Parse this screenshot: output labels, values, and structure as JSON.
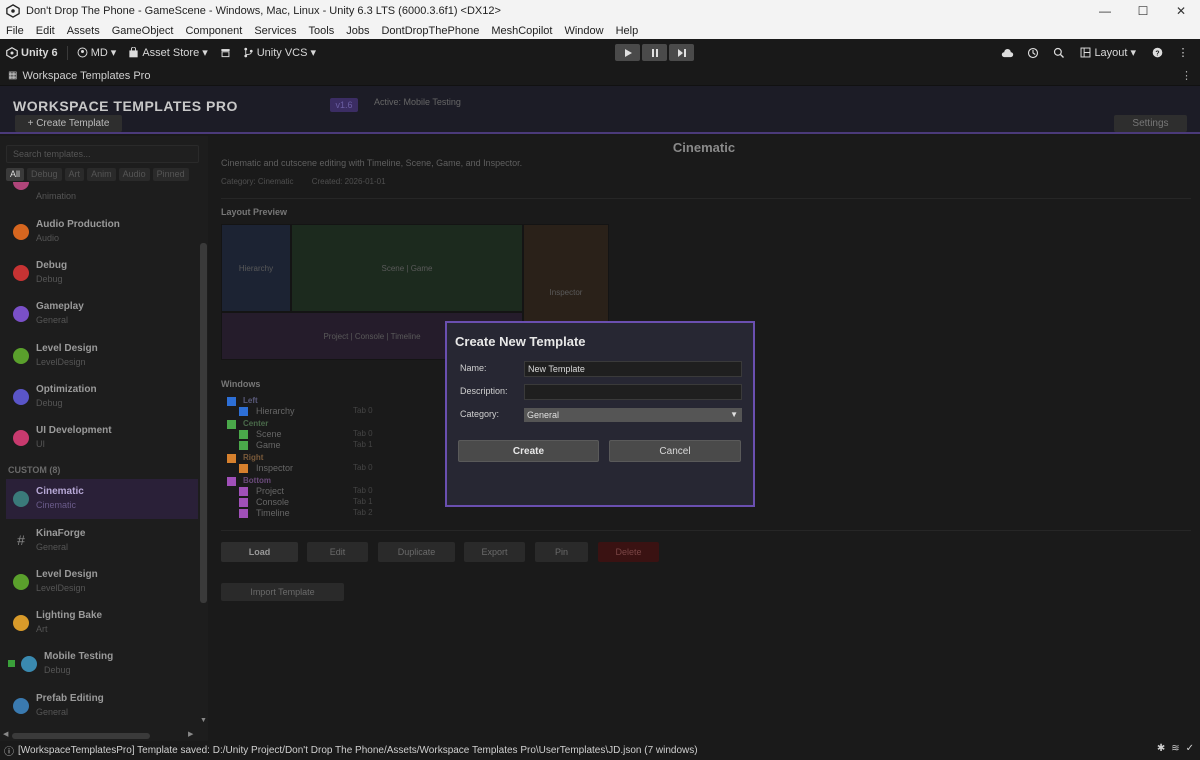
{
  "window": {
    "title": "Don't Drop The Phone - GameScene - Windows, Mac, Linux - Unity 6.3 LTS (6000.3.6f1) <DX12>",
    "controls": [
      "—",
      "☐",
      "✕"
    ]
  },
  "menu": [
    "File",
    "Edit",
    "Assets",
    "GameObject",
    "Component",
    "Services",
    "Tools",
    "Jobs",
    "DontDropThePhone",
    "MeshCopilot",
    "Window",
    "Help"
  ],
  "toolbar": {
    "unity_label": "Unity 6",
    "account_label": "MD",
    "asset_store_label": "Asset Store",
    "vcs_label": "Unity VCS",
    "layout_label": "Layout"
  },
  "window_tab": {
    "label": "Workspace Templates Pro"
  },
  "header": {
    "title": "WORKSPACE TEMPLATES PRO",
    "version": "v1.6",
    "active": "Active: Mobile Testing",
    "create_button": "+ Create Template",
    "settings_button": "Settings"
  },
  "sidebar": {
    "search_placeholder": "Search templates...",
    "filters": [
      "All",
      "Debug",
      "Art",
      "Anim",
      "Audio",
      "Pinned"
    ],
    "partial_top_category": "Animation",
    "builtin_templates": [
      {
        "name": "Audio Production",
        "category": "Audio",
        "color": "#d6661f"
      },
      {
        "name": "Debug",
        "category": "Debug",
        "color": "#c73333"
      },
      {
        "name": "Gameplay",
        "category": "General",
        "color": "#7a50c8"
      },
      {
        "name": "Level Design",
        "category": "LevelDesign",
        "color": "#5aa02c"
      },
      {
        "name": "Optimization",
        "category": "Debug",
        "color": "#5a55c8"
      },
      {
        "name": "UI Development",
        "category": "UI",
        "color": "#c83a6e"
      }
    ],
    "custom_header": "CUSTOM (8)",
    "custom_templates": [
      {
        "name": "Cinematic",
        "category": "Cinematic",
        "color": "#3a7a7a"
      },
      {
        "name": "KinaForge",
        "category": "General",
        "color": "#777777"
      },
      {
        "name": "Level Design",
        "category": "LevelDesign",
        "color": "#5aa02c"
      },
      {
        "name": "Lighting Bake",
        "category": "Art",
        "color": "#d89a2a"
      },
      {
        "name": "Mobile Testing",
        "category": "Debug",
        "color": "#3a8ab0"
      },
      {
        "name": "Prefab Editing",
        "category": "General",
        "color": "#3a7ab0"
      }
    ]
  },
  "details": {
    "title": "Cinematic",
    "description": "Cinematic and cutscene editing with Timeline, Scene, Game, and Inspector.",
    "category": "Category: Cinematic",
    "created": "Created: 2026-01-01",
    "layout_preview_header": "Layout Preview",
    "preview": {
      "hierarchy": "Hierarchy",
      "scene_game": "Scene | Game",
      "inspector": "Inspector",
      "bottom": "Project | Console | Timeline"
    },
    "windows_header": "Windows",
    "groups": [
      {
        "label": "Left",
        "color": "#2d6fd6",
        "items": [
          {
            "name": "Hierarchy",
            "tab": "Tab 0"
          }
        ]
      },
      {
        "label": "Center",
        "color": "#4aa84a",
        "items": [
          {
            "name": "Scene",
            "tab": "Tab 0"
          },
          {
            "name": "Game",
            "tab": "Tab 1"
          }
        ]
      },
      {
        "label": "Right",
        "color": "#d6802d",
        "items": [
          {
            "name": "Inspector",
            "tab": "Tab 0"
          }
        ]
      },
      {
        "label": "Bottom",
        "color": "#a050b8",
        "items": [
          {
            "name": "Project",
            "tab": "Tab 0"
          },
          {
            "name": "Console",
            "tab": "Tab 1"
          },
          {
            "name": "Timeline",
            "tab": "Tab 2"
          }
        ]
      }
    ],
    "actions": {
      "load": "Load",
      "edit": "Edit",
      "duplicate": "Duplicate",
      "export": "Export",
      "pin": "Pin",
      "delete": "Delete",
      "import": "Import Template"
    }
  },
  "modal": {
    "title": "Create New Template",
    "name_label": "Name:",
    "name_value": "New Template",
    "description_label": "Description:",
    "description_value": "",
    "category_label": "Category:",
    "category_value": "General",
    "create_button": "Create",
    "cancel_button": "Cancel"
  },
  "status": {
    "message": "[WorkspaceTemplatesPro] Template saved: D:/Unity Project/Don't Drop The Phone/Assets/Workspace Templates Pro\\UserTemplates\\JD.json (7 windows)"
  }
}
